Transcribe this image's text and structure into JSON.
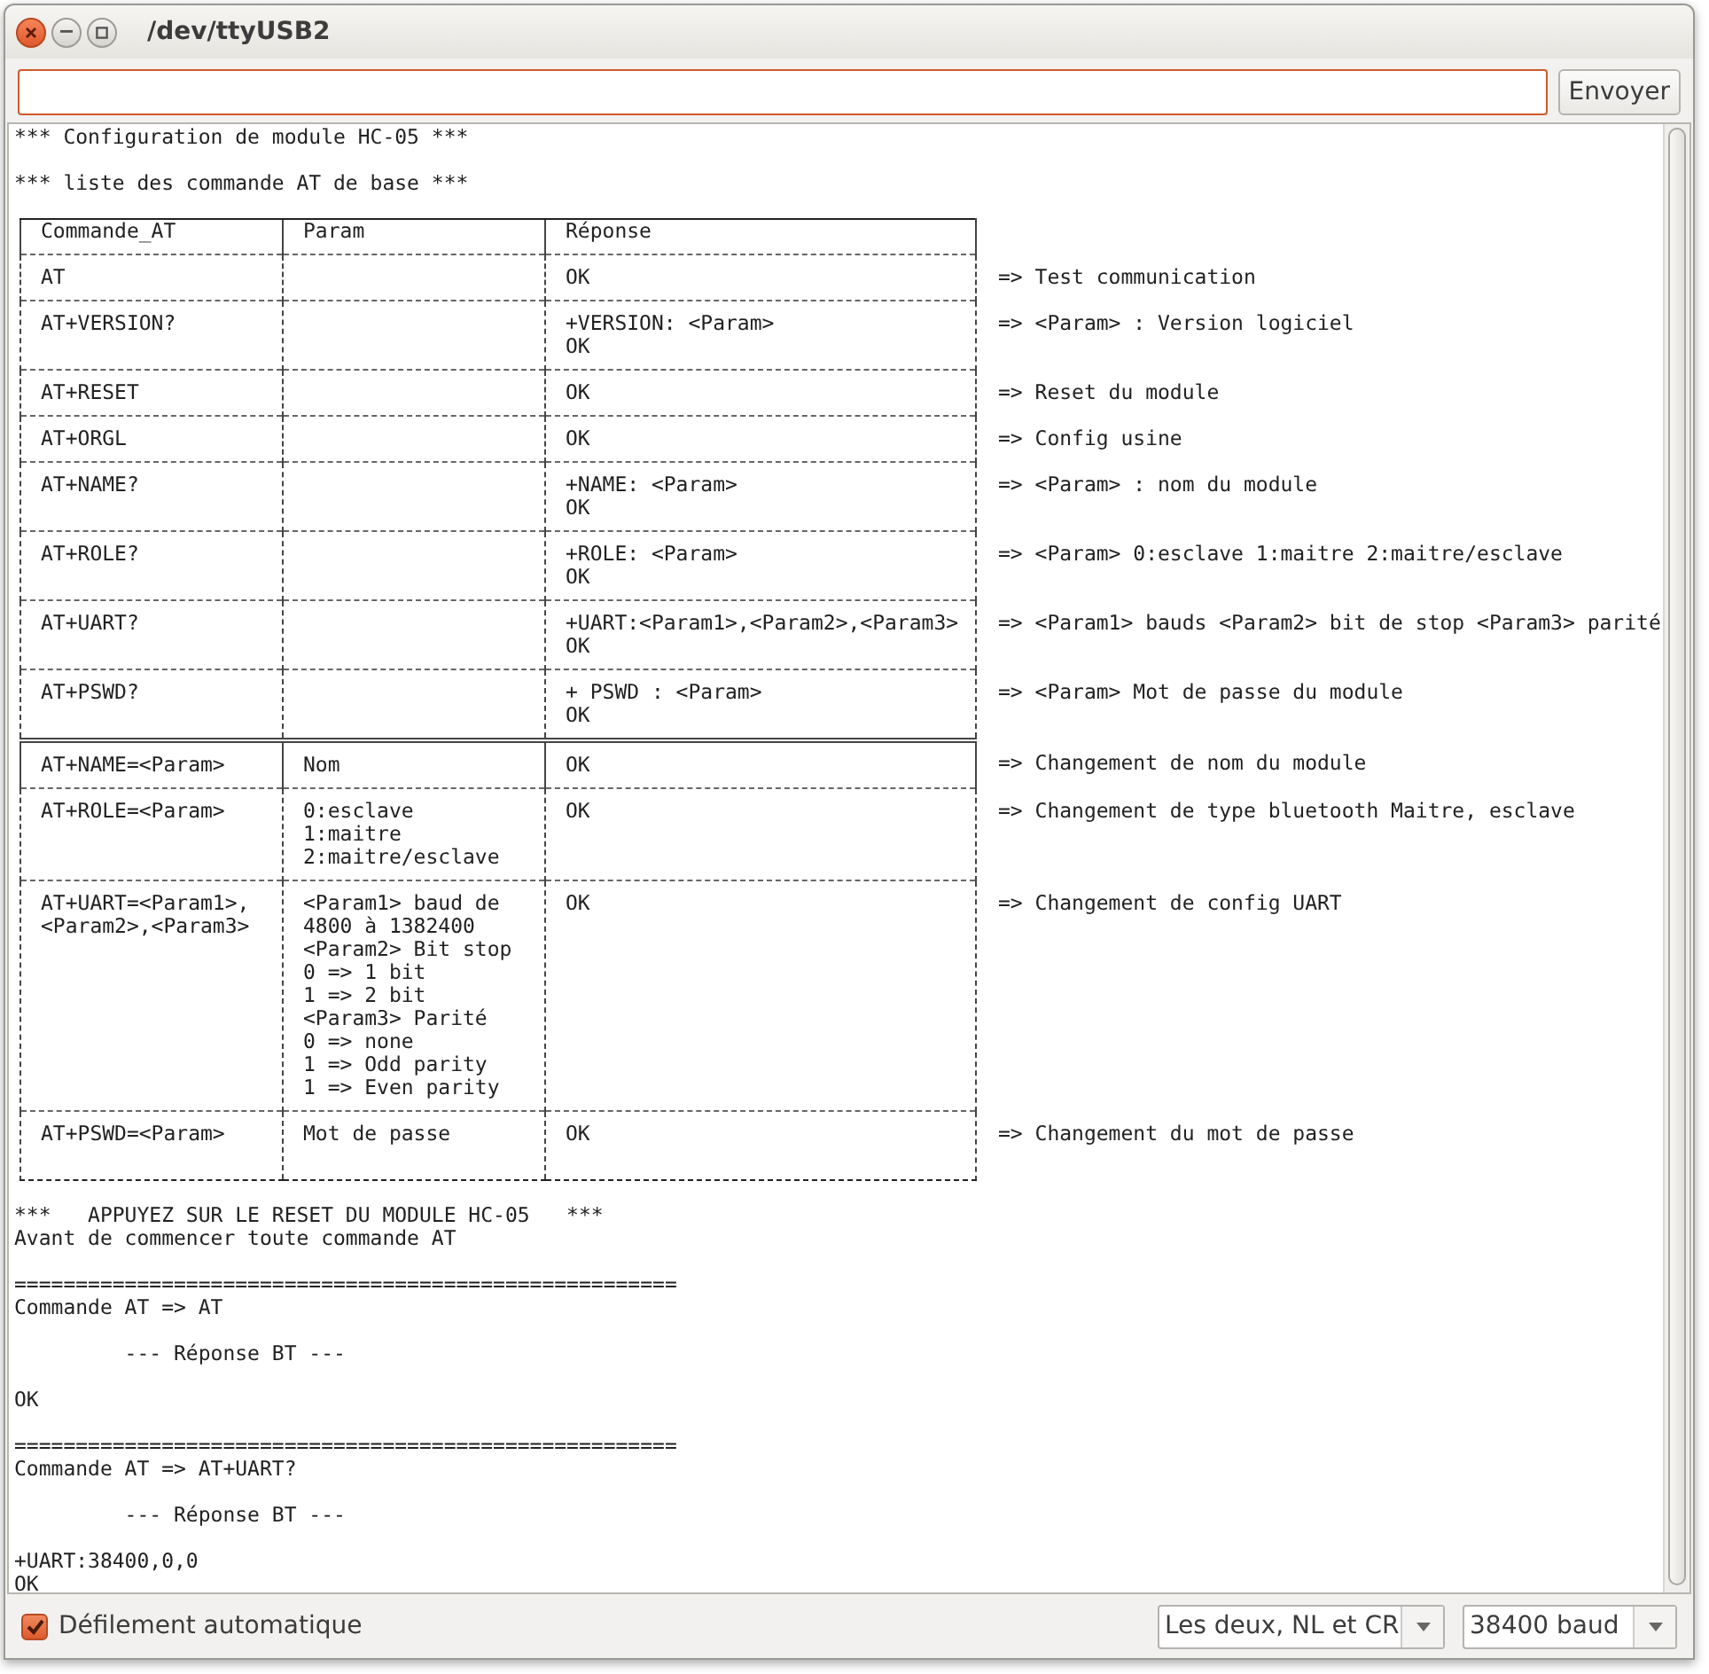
{
  "window": {
    "title": "/dev/ttyUSB2"
  },
  "send_button": "Envoyer",
  "output": {
    "intro": [
      "*** Configuration de module HC-05 ***",
      "*** liste des commande AT de base ***"
    ],
    "table": {
      "columns": [
        "Commande_AT",
        "Param",
        "Réponse"
      ],
      "groups": [
        [
          {
            "cells": [
              "AT",
              "",
              "OK"
            ],
            "note": "=> Test communication"
          },
          {
            "cells": [
              "AT+VERSION?",
              "",
              "+VERSION: <Param>\nOK"
            ],
            "note": "=> <Param> : Version logiciel"
          },
          {
            "cells": [
              "AT+RESET",
              "",
              "OK"
            ],
            "note": "=> Reset du module"
          },
          {
            "cells": [
              "AT+ORGL",
              "",
              "OK"
            ],
            "note": "=> Config usine"
          },
          {
            "cells": [
              "AT+NAME?",
              "",
              "+NAME: <Param>\nOK"
            ],
            "note": "=> <Param> : nom du module"
          },
          {
            "cells": [
              "AT+ROLE?",
              "",
              "+ROLE: <Param>\nOK"
            ],
            "note": "=> <Param> 0:esclave 1:maitre 2:maitre/esclave"
          },
          {
            "cells": [
              "AT+UART?",
              "",
              "+UART:<Param1>,<Param2>,<Param3>\nOK"
            ],
            "note": "=> <Param1> bauds <Param2> bit de stop <Param3> parité"
          },
          {
            "cells": [
              "AT+PSWD?",
              "",
              "+ PSWD : <Param>\nOK"
            ],
            "note": "=> <Param> Mot de passe du module"
          }
        ],
        [
          {
            "cells": [
              "AT+NAME=<Param>",
              "Nom",
              "OK"
            ],
            "note": "=> Changement de nom du module"
          },
          {
            "cells": [
              "AT+ROLE=<Param>",
              "0:esclave\n1:maitre\n2:maitre/esclave",
              "OK"
            ],
            "note": "=> Changement de type bluetooth Maitre, esclave"
          },
          {
            "cells": [
              "AT+UART=<Param1>,\n<Param2>,<Param3>",
              "<Param1> baud de\n4800 à 1382400\n<Param2> Bit stop\n0 => 1 bit\n1 => 2 bit\n<Param3> Parité\n0 => none\n1 => Odd parity\n1 => Even parity",
              "OK"
            ],
            "note": "=> Changement de config UART"
          },
          {
            "cells": [
              "AT+PSWD=<Param>",
              "Mot de passe",
              "OK"
            ],
            "note": "=> Changement du mot de passe"
          }
        ]
      ]
    },
    "log": [
      "***   APPUYEZ SUR LE RESET DU MODULE HC-05   ***\nAvant de commencer toute commande AT",
      "======================================================\nCommande AT => AT",
      "         --- Réponse BT ---",
      "OK",
      "======================================================\nCommande AT => AT+UART?",
      "         --- Réponse BT ---",
      "+UART:38400,0,0\nOK"
    ]
  },
  "autoscroll": {
    "label": "Défilement automatique",
    "checked": true
  },
  "line_ending": "Les deux, NL et CR",
  "baud": "38400 baud"
}
